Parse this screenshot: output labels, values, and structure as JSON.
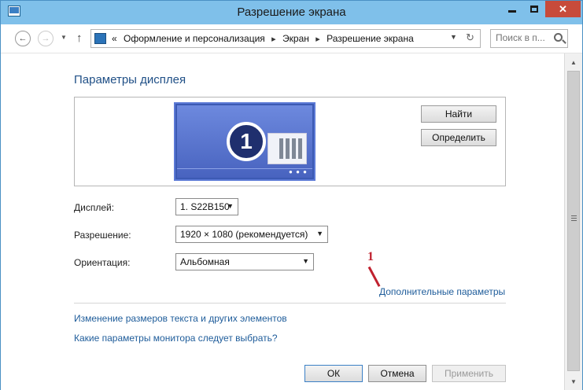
{
  "window": {
    "title": "Разрешение экрана",
    "close_glyph": "✕"
  },
  "nav": {
    "crumbs_prefix": "«",
    "crumbs": [
      "Оформление и персонализация",
      "Экран",
      "Разрешение экрана"
    ],
    "separator": "▸",
    "search_placeholder": "Поиск в п..."
  },
  "main": {
    "heading": "Параметры дисплея",
    "monitor_number": "1",
    "find_button": "Найти",
    "identify_button": "Определить",
    "display_label": "Дисплей:",
    "display_value": "1. S22B150",
    "resolution_label": "Разрешение:",
    "resolution_value": "1920 × 1080 (рекомендуется)",
    "orientation_label": "Ориентация:",
    "orientation_value": "Альбомная",
    "annotation_number": "1",
    "advanced_link": "Дополнительные параметры",
    "text_size_link": "Изменение размеров текста и других элементов",
    "monitor_help_link": "Какие параметры монитора следует выбрать?"
  },
  "footer": {
    "ok": "ОК",
    "cancel": "Отмена",
    "apply": "Применить",
    "apply_enabled": false
  },
  "colors": {
    "title_bar": "#7fc0ea",
    "close_button": "#c74b3b",
    "link": "#1e5c9a",
    "heading": "#1f4f86",
    "annotation": "#c0212f"
  },
  "icons": [
    "control-panel-icon",
    "minimize-icon",
    "maximize-icon",
    "close-icon",
    "back-arrow-icon",
    "forward-arrow-icon",
    "up-arrow-icon",
    "refresh-icon",
    "search-icon",
    "monitor-icon"
  ]
}
